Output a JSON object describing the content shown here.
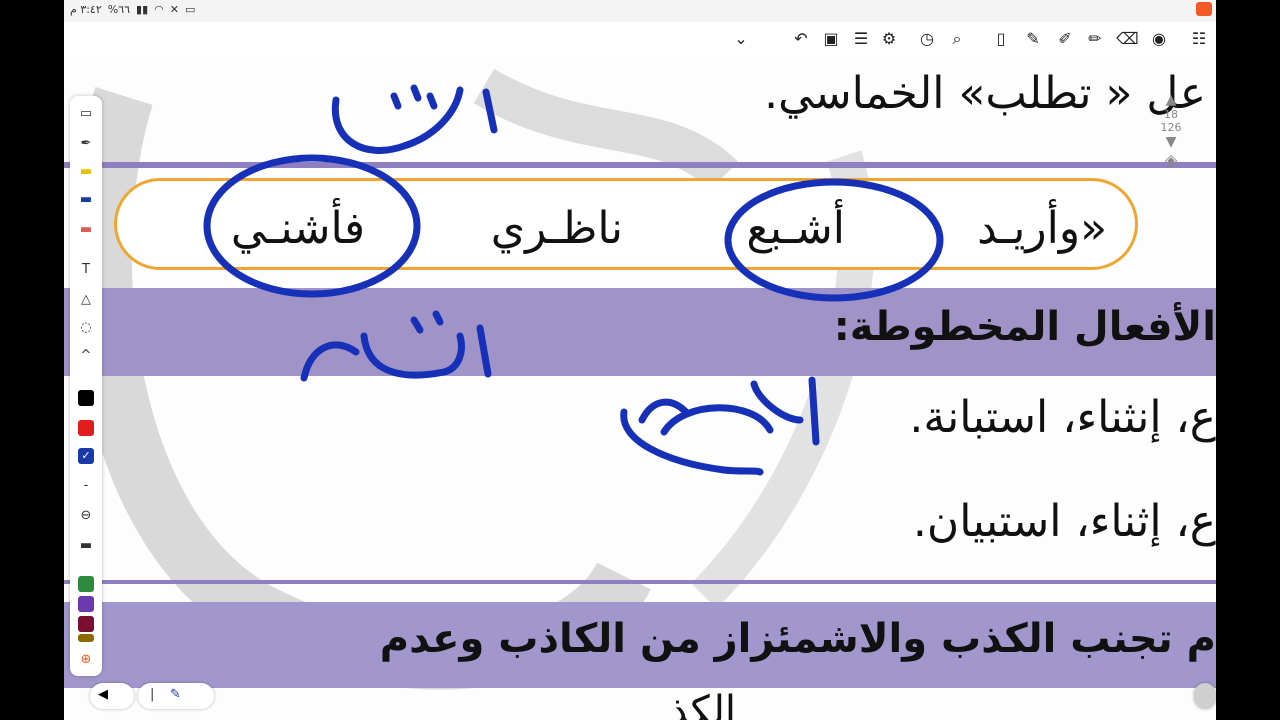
{
  "status_bar": {
    "time": "٣:٤٢ م",
    "battery": "%٦٦"
  },
  "toolbar": {
    "icons": [
      "undo-icon",
      "page-icon",
      "settings-icon",
      "list-icon",
      "clock-icon",
      "search-doc-icon",
      "blank-page-icon",
      "lasso-pen-icon",
      "pen-icon",
      "highlighter-icon",
      "eraser-icon",
      "mic-icon",
      "notes-icon"
    ]
  },
  "document": {
    "line1": "عل « تطلب» الخماسي.",
    "pill_words": [
      "«وأريـد",
      "أشـبع",
      "ناظـري",
      "فأشنـي"
    ],
    "heading": "الأفعال المخطوطة:",
    "line3": "ع، إنثناء، استبانة.",
    "line4": "ع، إثناء، استبيان.",
    "band_bottom": "م تجنب الكذب والاشمئزاز من الكاذب وعدم",
    "cut_line": "الكذ"
  },
  "handwriting": {
    "ink_color": "#1730b8",
    "notes": [
      "اشى",
      "انثناء",
      "اشباع"
    ]
  },
  "pager": {
    "current": "18",
    "total": "126"
  },
  "pen_palette": {
    "colors": [
      "#000000",
      "#e21d1d",
      "#1a3aa8",
      "#2d8a3e",
      "#6a3bb0",
      "#7a1030",
      "#8b6a00"
    ],
    "selected": "#1a3aa8"
  }
}
